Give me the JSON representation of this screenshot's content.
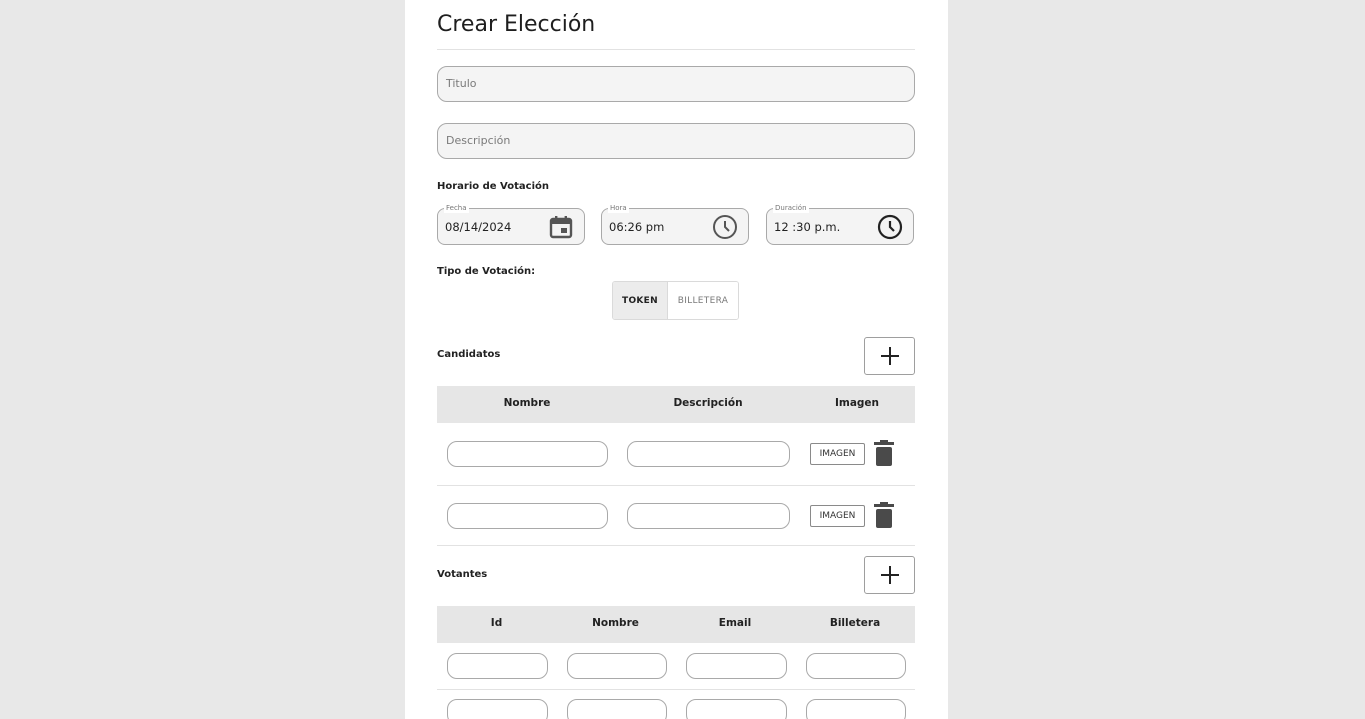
{
  "form": {
    "title": "Crear Elección",
    "title_field_placeholder": "Titulo",
    "description_field_placeholder": "Descripción"
  },
  "schedule": {
    "section_label": "Horario de Votación",
    "date": {
      "label": "Fecha",
      "value": "08/14/2024",
      "icon": "calendar-icon"
    },
    "time": {
      "label": "Hora",
      "value": "06:26 pm",
      "icon": "clock-icon"
    },
    "duration": {
      "label": "Duración",
      "value": "12 :30 p.m.",
      "icon": "clock-icon"
    }
  },
  "voting_type": {
    "section_label": "Tipo de Votación:",
    "options": [
      "TOKEN",
      "BILLETERA"
    ],
    "selected": "TOKEN"
  },
  "candidates": {
    "section_label": "Candidatos",
    "add_icon": "plus-icon",
    "columns": [
      "Nombre",
      "Descripción",
      "Imagen"
    ],
    "rows": [
      {
        "name": "",
        "description": "",
        "image_button": "IMAGEN",
        "delete_icon": "trash-icon"
      },
      {
        "name": "",
        "description": "",
        "image_button": "IMAGEN",
        "delete_icon": "trash-icon"
      }
    ]
  },
  "voters": {
    "section_label": "Votantes",
    "add_icon": "plus-icon",
    "columns": [
      "Id",
      "Nombre",
      "Email",
      "Billetera"
    ],
    "rows": [
      {
        "id": "",
        "name": "",
        "email": "",
        "wallet": ""
      },
      {
        "id": "",
        "name": "",
        "email": "",
        "wallet": ""
      }
    ]
  }
}
